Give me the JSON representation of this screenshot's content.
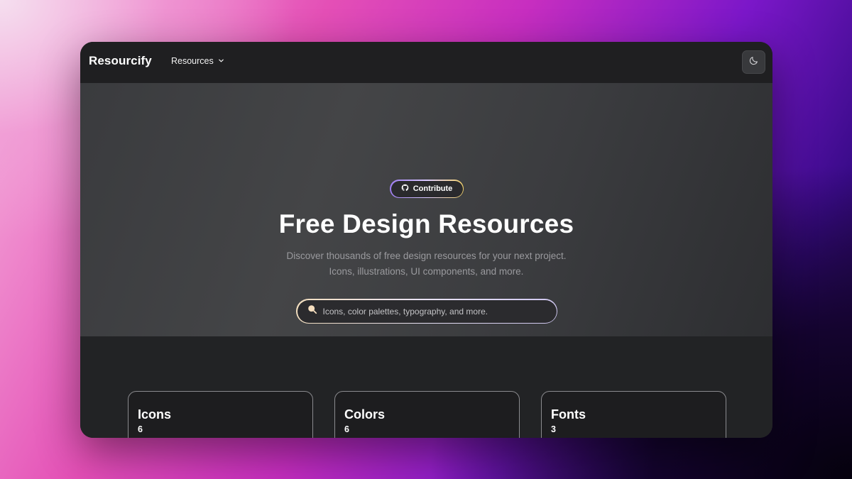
{
  "navbar": {
    "brand": "Resourcify",
    "resources_label": "Resources",
    "resources_icon": "chevron-down-icon",
    "theme_icon": "moon-icon"
  },
  "hero": {
    "contribute_label": "Contribute",
    "contribute_icon": "github-icon",
    "title": "Free Design Resources",
    "subtitle": "Discover thousands of free design resources for your next project. Icons, illustrations, UI components, and more.",
    "search_placeholder": "Icons, color palettes, typography, and more.",
    "search_value": "",
    "search_icon": "search-icon"
  },
  "categories": [
    {
      "title": "Icons",
      "count": "6"
    },
    {
      "title": "Colors",
      "count": "6"
    },
    {
      "title": "Fonts",
      "count": "3"
    }
  ],
  "colors": {
    "hero_background": "#404144",
    "page_background": "#222325",
    "navbar_background": "#1f1f21",
    "accent_gradient_start": "#9d7cf0",
    "accent_gradient_end": "#f2d16a"
  }
}
